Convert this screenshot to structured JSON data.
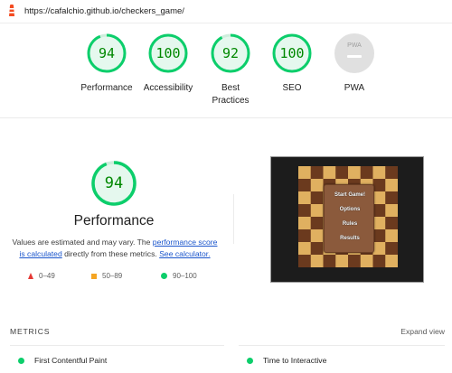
{
  "url": "https://cafalchio.github.io/checkers_game/",
  "colors": {
    "pass": "#0cce6b",
    "pass_text": "#008800",
    "average": "#f5a523",
    "fail": "#e53935",
    "na": "#bdbdbd",
    "link": "#1a55cc"
  },
  "gauges": [
    {
      "label": "Performance",
      "score": "94",
      "fraction": 0.94
    },
    {
      "label": "Accessibility",
      "score": "100",
      "fraction": 1.0
    },
    {
      "label": "Best Practices",
      "score": "92",
      "fraction": 0.92
    },
    {
      "label": "SEO",
      "score": "100",
      "fraction": 1.0
    },
    {
      "label": "PWA",
      "badge": "PWA"
    }
  ],
  "performance": {
    "score": "94",
    "fraction": 0.94,
    "title": "Performance",
    "desc_prefix": "Values are estimated and may vary. The ",
    "desc_link1": "performance score is calculated",
    "desc_mid": " directly from these metrics. ",
    "desc_link2": "See calculator."
  },
  "legend": [
    {
      "icon": "triangle-icon",
      "range": "0–49"
    },
    {
      "icon": "square-icon",
      "range": "50–89"
    },
    {
      "icon": "circle-icon",
      "range": "90–100"
    }
  ],
  "screenshot": {
    "menu": [
      "Start Game!",
      "Options",
      "Rules",
      "Results"
    ]
  },
  "metrics": {
    "heading": "METRICS",
    "expand": "Expand view",
    "items": [
      "First Contentful Paint",
      "Time to Interactive"
    ]
  }
}
